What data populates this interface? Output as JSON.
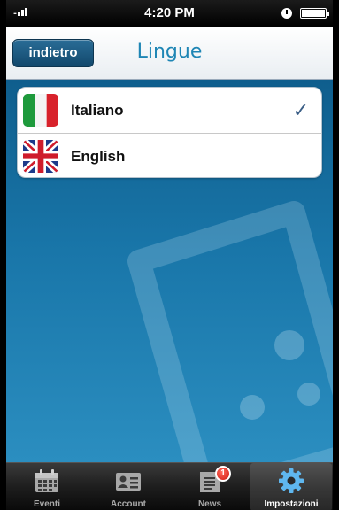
{
  "status_bar": {
    "time": "4:20 PM"
  },
  "nav": {
    "back_label": "indietro",
    "title": "Lingue"
  },
  "languages": [
    {
      "label": "Italiano",
      "flag": "italy-flag",
      "selected": true
    },
    {
      "label": "English",
      "flag": "uk-flag",
      "selected": false
    }
  ],
  "checkmark": "✓",
  "tabs": [
    {
      "label": "Eventi",
      "icon": "calendar-icon",
      "active": false
    },
    {
      "label": "Account",
      "icon": "id-card-icon",
      "active": false
    },
    {
      "label": "News",
      "icon": "news-icon",
      "active": false,
      "badge": "1"
    },
    {
      "label": "Impostazioni",
      "icon": "gear-icon",
      "active": true
    }
  ],
  "colors": {
    "accent": "#1f86b5",
    "background": "#1976a9",
    "back_button": "#1a5a82"
  }
}
